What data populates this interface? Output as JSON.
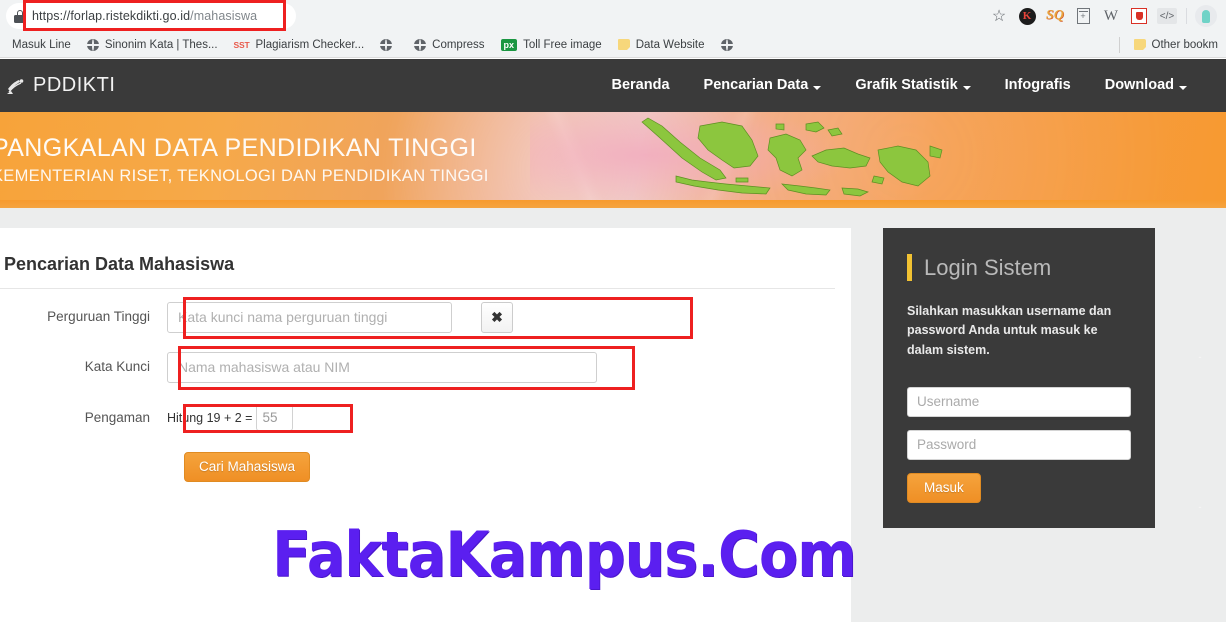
{
  "browser": {
    "url_secure_part": "https://forlap.ristekdikti.go.id",
    "url_path": "/mahasiswa",
    "lock_icon": "lock-icon",
    "star_icon": "bookmark-star-icon",
    "extensions": [
      {
        "name": "kaspersky-extension-icon",
        "label": "K"
      },
      {
        "name": "sq-extension-icon",
        "label": "SQ"
      },
      {
        "name": "document-extension-icon",
        "label": "+"
      },
      {
        "name": "wikipedia-extension-icon",
        "label": "W"
      },
      {
        "name": "adblock-shield-extension-icon",
        "label": ""
      },
      {
        "name": "code-extension-icon",
        "label": "</>"
      }
    ],
    "bookmarks": [
      {
        "label": "Masuk Line",
        "icon": "none"
      },
      {
        "label": "Sinonim Kata | Thes...",
        "icon": "globe-icon"
      },
      {
        "label": "Plagiarism Checker...",
        "icon": "sst-icon"
      },
      {
        "label": "",
        "icon": "globe-icon"
      },
      {
        "label": "Compress",
        "icon": "globe-icon"
      },
      {
        "label": "Toll Free image",
        "icon": "px-icon"
      },
      {
        "label": "Data Website",
        "icon": "folder-icon"
      },
      {
        "label": "",
        "icon": "globe-icon"
      }
    ],
    "other_bookmarks": "Other bookm"
  },
  "site": {
    "brand": "PDDIKTI",
    "nav": [
      {
        "label": "Beranda",
        "caret": false
      },
      {
        "label": "Pencarian Data",
        "caret": true
      },
      {
        "label": "Grafik Statistik",
        "caret": true
      },
      {
        "label": "Infografis",
        "caret": false
      },
      {
        "label": "Download",
        "caret": true
      }
    ],
    "banner": {
      "line1": "PANGKALAN DATA PENDIDIKAN TINGGI",
      "line2": "KEMENTERIAN RISET, TEKNOLOGI DAN PENDIDIKAN TINGGI",
      "map_icon": "indonesia-map-image"
    }
  },
  "form": {
    "title": "Pencarian Data Mahasiswa",
    "labels": {
      "perguruan_tinggi": "Perguruan Tinggi",
      "kata_kunci": "Kata Kunci",
      "pengaman": "Pengaman"
    },
    "perguruan_tinggi_placeholder": "Kata kunci nama perguruan tinggi",
    "perguruan_tinggi_value": "",
    "kata_kunci_placeholder": "Nama mahasiswa atau NIM",
    "kata_kunci_value": "",
    "clear_button": "✖",
    "captcha_question": "Hitung 19 + 2 =",
    "captcha_value": "55",
    "submit_label": "Cari Mahasiswa"
  },
  "login": {
    "title": "Login Sistem",
    "description": "Silahkan masukkan username dan password Anda untuk masuk ke dalam sistem.",
    "username_placeholder": "Username",
    "username_value": "",
    "password_placeholder": "Password",
    "password_value": "",
    "submit_label": "Masuk"
  },
  "watermark": "FaktaKampus.Com",
  "colors": {
    "nav_dark": "#3a3a3a",
    "accent_orange": "#f5a33c",
    "highlight_red": "#ee2020",
    "login_accent_yellow": "#f2c232",
    "watermark_purple": "#5b1ff0"
  }
}
